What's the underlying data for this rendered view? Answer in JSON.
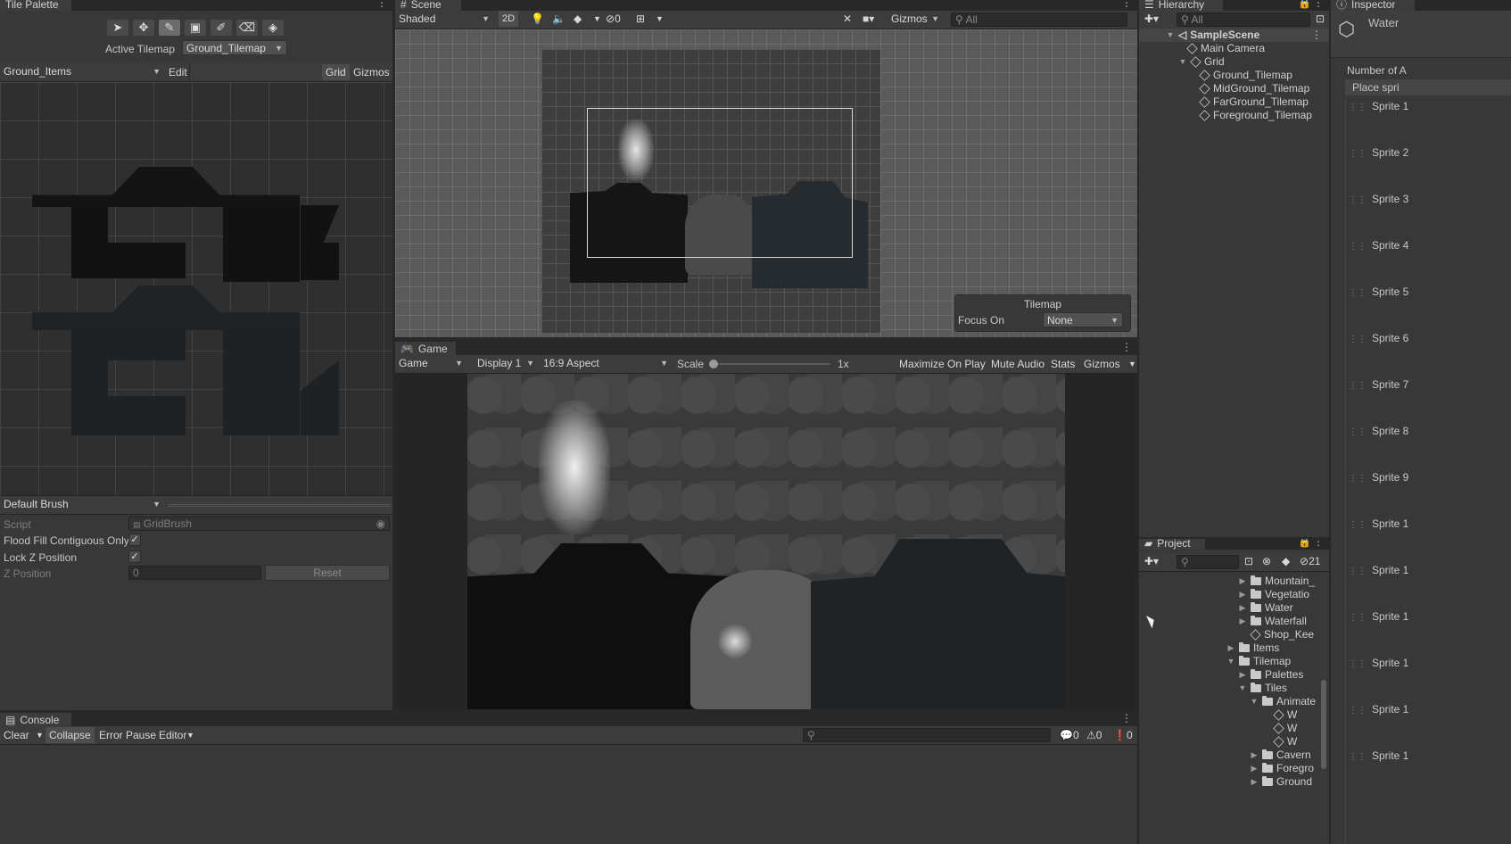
{
  "tile_palette": {
    "title": "Tile Palette",
    "active_tilemap_label": "Active Tilemap",
    "active_tilemap_value": "Ground_Tilemap",
    "palette_name": "Ground_Items",
    "edit_label": "Edit",
    "grid_label": "Grid",
    "gizmos_label": "Gizmos",
    "brush_name": "Default Brush",
    "script_label": "Script",
    "script_value": "GridBrush",
    "flood_fill_label": "Flood Fill Contiguous Only",
    "lock_z_label": "Lock Z Position",
    "z_position_label": "Z Position",
    "z_position_value": "0",
    "reset_label": "Reset",
    "tools": [
      "select-icon",
      "move-icon",
      "paint-brush-icon",
      "box-fill-icon",
      "picker-icon",
      "eraser-icon",
      "fill-bucket-icon"
    ]
  },
  "scene": {
    "title": "Scene",
    "shading_mode": "Shaded",
    "mode_2d": "2D",
    "hidden_count": "0",
    "gizmos_label": "Gizmos",
    "search_placeholder": "All",
    "overlay_title": "Tilemap",
    "focus_on_label": "Focus On",
    "focus_on_value": "None"
  },
  "game": {
    "title": "Game",
    "view_mode": "Game",
    "display": "Display 1",
    "aspect": "16:9 Aspect",
    "scale_label": "Scale",
    "scale_value": "1x",
    "maximize_on_play": "Maximize On Play",
    "mute_audio": "Mute Audio",
    "stats": "Stats",
    "gizmos": "Gizmos"
  },
  "hierarchy": {
    "title": "Hierarchy",
    "search_placeholder": "All",
    "scene_name": "SampleScene",
    "items": [
      {
        "label": "Main Camera",
        "indent": 1
      },
      {
        "label": "Grid",
        "indent": 1
      },
      {
        "label": "Ground_Tilemap",
        "indent": 2
      },
      {
        "label": "MidGround_Tilemap",
        "indent": 2
      },
      {
        "label": "FarGround_Tilemap",
        "indent": 2
      },
      {
        "label": "Foreground_Tilemap",
        "indent": 2
      }
    ]
  },
  "project": {
    "title": "Project",
    "hidden_count": "21",
    "items": [
      {
        "label": "Mountain_",
        "indent": 3,
        "type": "folder"
      },
      {
        "label": "Vegetatio",
        "indent": 3,
        "type": "folder"
      },
      {
        "label": "Water",
        "indent": 3,
        "type": "folder"
      },
      {
        "label": "Waterfall",
        "indent": 3,
        "type": "folder"
      },
      {
        "label": "Shop_Kee",
        "indent": 3,
        "type": "asset"
      },
      {
        "label": "Items",
        "indent": 2,
        "type": "folder"
      },
      {
        "label": "Tilemap",
        "indent": 2,
        "type": "folder"
      },
      {
        "label": "Palettes",
        "indent": 3,
        "type": "folder"
      },
      {
        "label": "Tiles",
        "indent": 3,
        "type": "folder"
      },
      {
        "label": "Animate",
        "indent": 4,
        "type": "folder"
      },
      {
        "label": "W",
        "indent": 5,
        "type": "asset"
      },
      {
        "label": "W",
        "indent": 5,
        "type": "asset"
      },
      {
        "label": "W",
        "indent": 5,
        "type": "asset"
      },
      {
        "label": "Cavern",
        "indent": 4,
        "type": "folder"
      },
      {
        "label": "Foregro",
        "indent": 4,
        "type": "folder"
      },
      {
        "label": "Ground",
        "indent": 4,
        "type": "folder"
      }
    ]
  },
  "inspector": {
    "title": "Inspector",
    "object_name": "Water",
    "number_label": "Number of A",
    "place_label": "Place spri",
    "sprites": [
      "Sprite 1",
      "Sprite 2",
      "Sprite 3",
      "Sprite 4",
      "Sprite 5",
      "Sprite 6",
      "Sprite 7",
      "Sprite 8",
      "Sprite 9",
      "Sprite 1",
      "Sprite 1",
      "Sprite 1",
      "Sprite 1",
      "Sprite 1",
      "Sprite 1"
    ]
  },
  "console": {
    "title": "Console",
    "clear": "Clear",
    "collapse": "Collapse",
    "error_pause": "Error Pause",
    "editor": "Editor",
    "log_count": "0",
    "warning_count": "0",
    "error_count": "0"
  }
}
